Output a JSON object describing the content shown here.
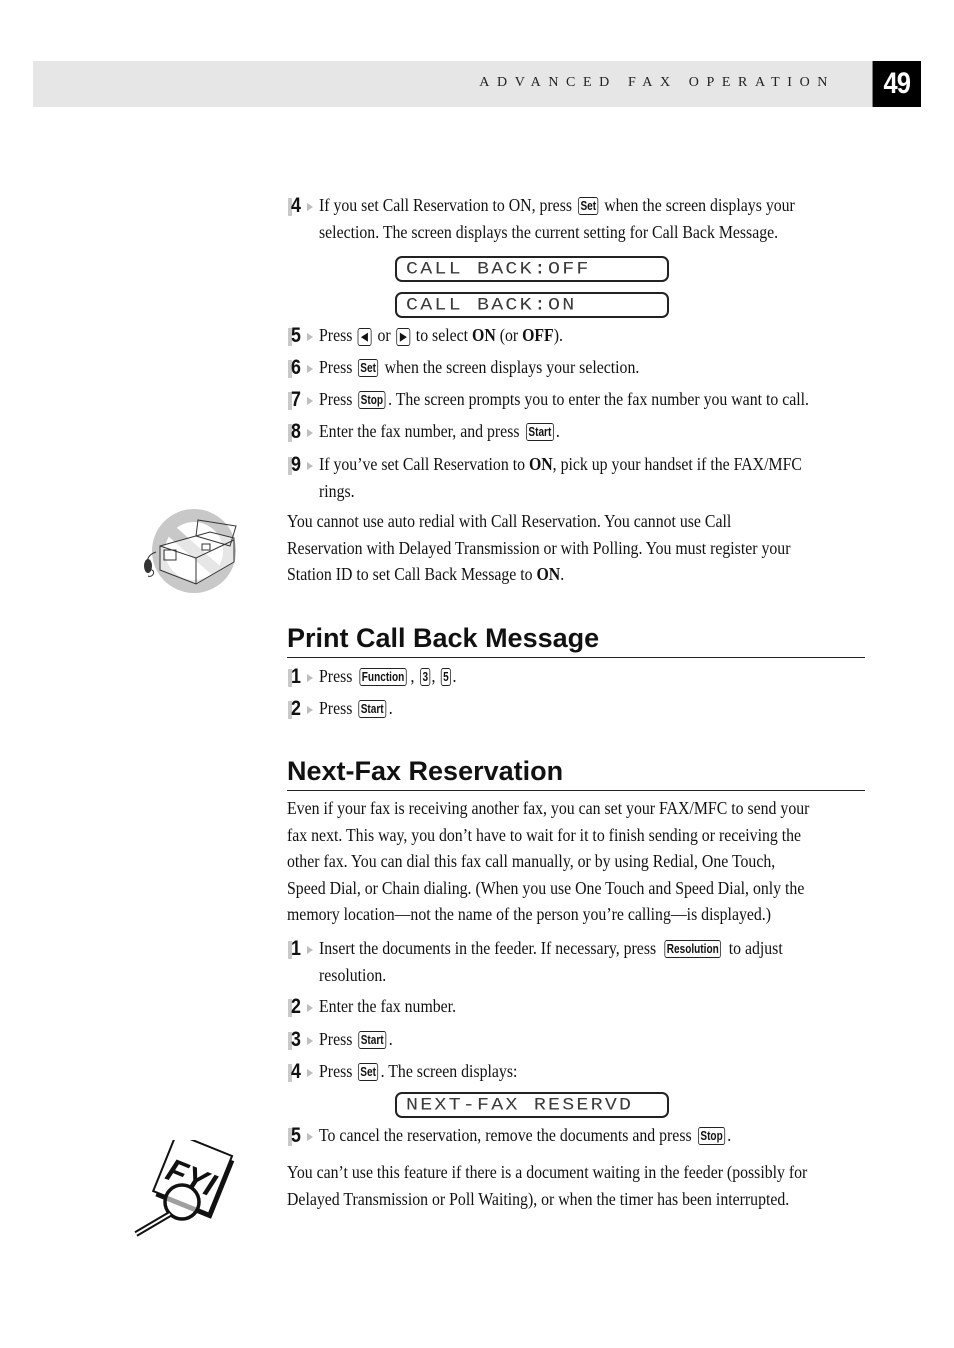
{
  "header": {
    "section_title": "ADVANCED FAX OPERATION",
    "page_number": "49"
  },
  "call_back_steps_top": {
    "step4": {
      "number": "4",
      "line1_a": "If you set Call Reservation to ON, press ",
      "key": "Set",
      "line1_b": " when the screen displays your",
      "line2": "selection. The screen displays the current setting for Call Back Message."
    },
    "lcd_off": "CALL BACK:OFF",
    "lcd_on": "CALL BACK:ON",
    "step5": {
      "number": "5",
      "a": "Press ",
      "key_left": "◀",
      "b": " or ",
      "key_right": "▶",
      "c": " to select ",
      "bold1": "ON",
      "d": " (or ",
      "bold2": "OFF",
      "e": ")."
    },
    "step6": {
      "number": "6",
      "a": "Press ",
      "key": "Set",
      "b": " when the screen displays your selection."
    },
    "step7": {
      "number": "7",
      "a": "Press ",
      "key": "Stop",
      "b": ". The screen prompts you to enter the fax number you want to call."
    },
    "step8": {
      "number": "8",
      "a": "Enter the fax number, and press ",
      "key": "Start",
      "b": "."
    },
    "step9": {
      "number": "9",
      "a": "If you’ve set Call Reservation to ",
      "bold": "ON",
      "b": ", pick up your handset if the FAX/MFC",
      "line2": "rings."
    }
  },
  "note1": {
    "icon": "fax-machine-prohibited-icon",
    "line1": "You cannot use auto redial with Call Reservation. You cannot use Call",
    "line2": "Reservation with Delayed Transmission or with Polling. You must register your",
    "line3_a": "Station ID to set Call Back Message to ",
    "line3_bold": "ON",
    "line3_b": "."
  },
  "print_call_back": {
    "heading": "Print Call Back Message",
    "step1": {
      "number": "1",
      "a": "Press ",
      "key1": "Function",
      "sep1": ", ",
      "key2": "3",
      "sep2": ", ",
      "key3": "5",
      "end": "."
    },
    "step2": {
      "number": "2",
      "a": "Press ",
      "key": "Start",
      "end": "."
    }
  },
  "next_fax": {
    "heading": "Next-Fax Reservation",
    "intro": [
      "Even if your fax is receiving another fax, you can set your FAX/MFC to send your",
      "fax next. This way, you don’t have to wait for it to finish sending or receiving the",
      "other fax. You can dial this fax call manually, or by using Redial, One Touch,",
      "Speed Dial, or Chain dialing. (When you use One Touch and Speed Dial, only the",
      "memory location—not the name of the person you’re calling—is displayed.)"
    ],
    "step1": {
      "number": "1",
      "a": "Insert the documents in the feeder. If necessary, press ",
      "key": "Resolution",
      "b": " to adjust",
      "line2": "resolution."
    },
    "step2": {
      "number": "2",
      "text": "Enter the fax number."
    },
    "step3": {
      "number": "3",
      "a": "Press ",
      "key": "Start",
      "end": "."
    },
    "step4": {
      "number": "4",
      "a": "Press ",
      "key": "Set",
      "b": ". The screen displays:"
    },
    "lcd": "NEXT-FAX RESERVD",
    "step5": {
      "number": "5",
      "a": "To cancel the reservation, remove the documents and press ",
      "key": "Stop",
      "end": "."
    }
  },
  "note2": {
    "icon": "fyi-magnifier-icon",
    "line1": "You can’t use this feature if there is a document waiting in the feeder (possibly for",
    "line2": "Delayed Transmission or Poll Waiting), or when the timer has been interrupted."
  }
}
